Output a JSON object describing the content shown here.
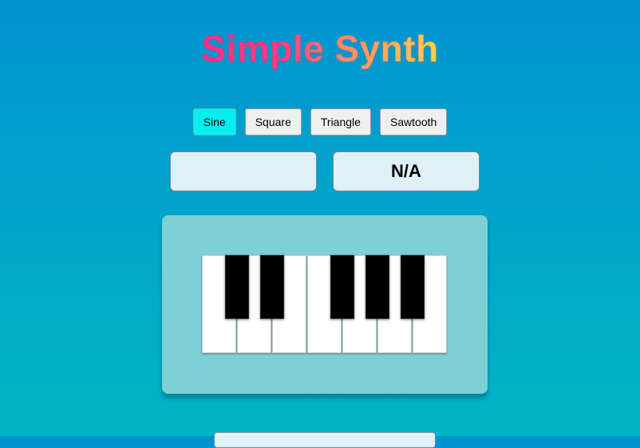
{
  "app": {
    "title": "Simple Synth"
  },
  "waveforms": [
    {
      "label": "Sine",
      "active": true
    },
    {
      "label": "Square",
      "active": false
    },
    {
      "label": "Triangle",
      "active": false
    },
    {
      "label": "Sawtooth",
      "active": false
    }
  ],
  "displays": {
    "left_value": "",
    "right_value": "N/A"
  },
  "keyboard": {
    "white_keys": 7,
    "black_keys": 5
  },
  "colors": {
    "active_waveform": "#00f0f0",
    "title_gradient_start": "#ff2d8e",
    "title_gradient_end": "#ffd34a",
    "panel": "#7dd0d4"
  }
}
